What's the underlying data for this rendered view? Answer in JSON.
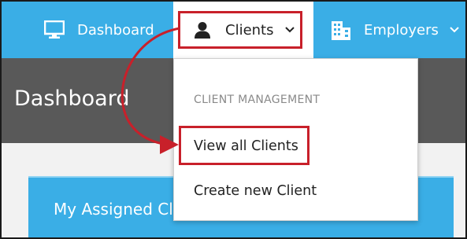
{
  "nav": {
    "dashboard_label": "Dashboard",
    "clients_label": "Clients",
    "employers_label": "Employers",
    "icons": {
      "dashboard": "monitor-icon",
      "clients": "person-icon",
      "employers": "building-icon",
      "chevron": "chevron-down-icon"
    }
  },
  "page": {
    "title": "Dashboard",
    "card_title": "My Assigned Clients"
  },
  "dropdown": {
    "section_header": "CLIENT MANAGEMENT",
    "items": [
      {
        "label": "View all Clients"
      },
      {
        "label": "Create new Client"
      }
    ]
  },
  "colors": {
    "nav_background": "#3aaee6",
    "header_background": "#595959",
    "highlight": "#c8202a",
    "card_background": "#3aaee6"
  }
}
